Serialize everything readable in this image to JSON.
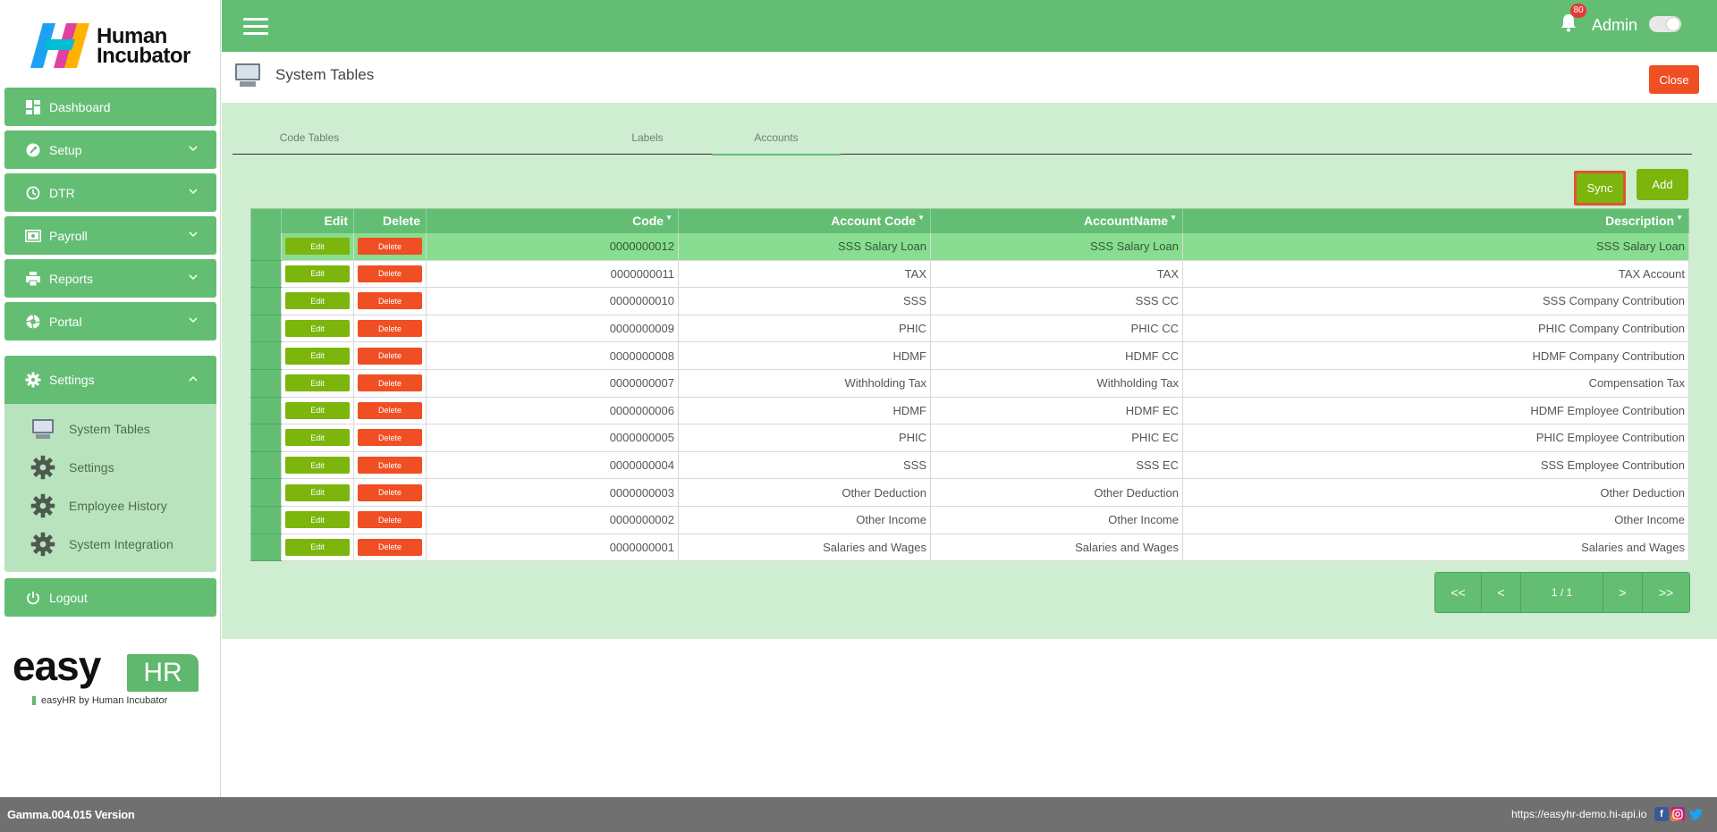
{
  "brand": {
    "line1": "Human",
    "line2": "Incubator"
  },
  "sidebar": {
    "items": [
      {
        "label": "Dashboard"
      },
      {
        "label": "Setup"
      },
      {
        "label": "DTR"
      },
      {
        "label": "Payroll"
      },
      {
        "label": "Reports"
      },
      {
        "label": "Portal"
      }
    ],
    "settings_label": "Settings",
    "submenu": [
      {
        "label": "System Tables"
      },
      {
        "label": "Settings"
      },
      {
        "label": "Employee History"
      },
      {
        "label": "System Integration"
      }
    ],
    "logout_label": "Logout"
  },
  "easyhr": {
    "easy": "easy",
    "hr": "HR",
    "by": "easyHR by Human Incubator"
  },
  "topbar": {
    "notification_count": "80",
    "user": "Admin"
  },
  "page": {
    "title": "System Tables",
    "close_label": "Close"
  },
  "tabs": [
    {
      "label": "Code Tables"
    },
    {
      "label": "Labels"
    },
    {
      "label": "Accounts",
      "active": true
    }
  ],
  "actions": {
    "sync_label": "Sync",
    "add_label": "Add"
  },
  "table": {
    "columns": [
      "Edit",
      "Delete",
      "Code",
      "Account Code",
      "AccountName",
      "Description"
    ],
    "sort_glyph": "▼",
    "edit_label": "Edit",
    "delete_label": "Delete",
    "rows": [
      {
        "code": "0000000012",
        "account_code": "SSS Salary Loan",
        "account_name": "SSS Salary Loan",
        "description": "SSS Salary Loan"
      },
      {
        "code": "0000000011",
        "account_code": "TAX",
        "account_name": "TAX",
        "description": "TAX Account"
      },
      {
        "code": "0000000010",
        "account_code": "SSS",
        "account_name": "SSS CC",
        "description": "SSS Company Contribution"
      },
      {
        "code": "0000000009",
        "account_code": "PHIC",
        "account_name": "PHIC CC",
        "description": "PHIC Company Contribution"
      },
      {
        "code": "0000000008",
        "account_code": "HDMF",
        "account_name": "HDMF CC",
        "description": "HDMF Company Contribution"
      },
      {
        "code": "0000000007",
        "account_code": "Withholding Tax",
        "account_name": "Withholding Tax",
        "description": "Compensation Tax"
      },
      {
        "code": "0000000006",
        "account_code": "HDMF",
        "account_name": "HDMF EC",
        "description": "HDMF Employee Contribution"
      },
      {
        "code": "0000000005",
        "account_code": "PHIC",
        "account_name": "PHIC EC",
        "description": "PHIC Employee Contribution"
      },
      {
        "code": "0000000004",
        "account_code": "SSS",
        "account_name": "SSS EC",
        "description": "SSS Employee Contribution"
      },
      {
        "code": "0000000003",
        "account_code": "Other Deduction",
        "account_name": "Other Deduction",
        "description": "Other Deduction"
      },
      {
        "code": "0000000002",
        "account_code": "Other Income",
        "account_name": "Other Income",
        "description": "Other Income"
      },
      {
        "code": "0000000001",
        "account_code": "Salaries and Wages",
        "account_name": "Salaries and Wages",
        "description": "Salaries and Wages"
      }
    ]
  },
  "pager": {
    "first": "<<",
    "prev": "<",
    "page": "1 / 1",
    "next": ">",
    "last": ">>"
  },
  "footer": {
    "version": "Gamma.004.015 Version",
    "url": "https://easyhr-demo.hi-api.io",
    "facebook": "f"
  },
  "colors": {
    "primary": "#63be74",
    "accent_green": "#7cb50c",
    "danger": "#f04e23",
    "content_bg": "#cfedd0",
    "footer_bg": "#707070"
  }
}
